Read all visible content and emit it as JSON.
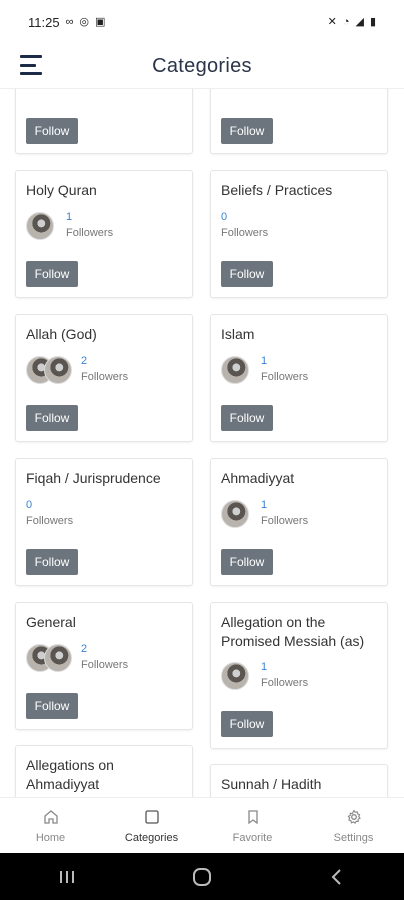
{
  "status_bar": {
    "time": "11:25",
    "left_glyphs": [
      "∞",
      "◎",
      "▣"
    ],
    "right_glyphs": [
      "✕",
      "◔",
      "◢",
      "▮"
    ]
  },
  "header": {
    "title": "Categories"
  },
  "follow_label": "Follow",
  "followers_label": "Followers",
  "categories": [
    {
      "title": "",
      "followers": "",
      "avatars": 0
    },
    {
      "title": "",
      "followers": "",
      "avatars": 0
    },
    {
      "title": "Holy Quran",
      "followers": "1",
      "avatars": 1
    },
    {
      "title": "Beliefs / Practices",
      "followers": "0",
      "avatars": 0
    },
    {
      "title": "Allah (God)",
      "followers": "2",
      "avatars": 2
    },
    {
      "title": "Islam",
      "followers": "1",
      "avatars": 1
    },
    {
      "title": "Fiqah / Jurisprudence",
      "followers": "0",
      "avatars": 0
    },
    {
      "title": "Ahmadiyyat",
      "followers": "1",
      "avatars": 1
    },
    {
      "title": "General",
      "followers": "2",
      "avatars": 2
    },
    {
      "title": "Allegation on the Promised Messiah (as)",
      "followers": "1",
      "avatars": 1
    },
    {
      "title": "Allegations on Ahmadiyyat",
      "followers": "",
      "avatars": 0
    },
    {
      "title": "Sunnah / Hadith",
      "followers": "",
      "avatars": 0
    }
  ],
  "bottom_nav": [
    {
      "label": "Home",
      "icon": "home-icon"
    },
    {
      "label": "Categories",
      "icon": "square-icon",
      "active": true
    },
    {
      "label": "Favorite",
      "icon": "bookmark-icon"
    },
    {
      "label": "Settings",
      "icon": "gear-icon"
    }
  ],
  "system_nav": [
    {
      "icon": "recent-apps-icon"
    },
    {
      "icon": "home-circle-icon"
    },
    {
      "icon": "back-icon"
    }
  ]
}
